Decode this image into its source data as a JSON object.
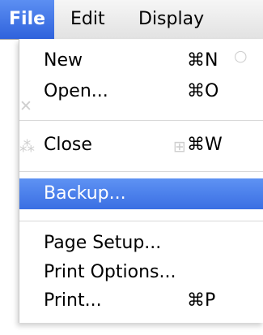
{
  "menubar": {
    "items": [
      {
        "label": "File"
      },
      {
        "label": "Edit"
      },
      {
        "label": "Display"
      }
    ]
  },
  "file_menu": {
    "items": [
      {
        "label": "New",
        "shortcut": "⌘N"
      },
      {
        "label": "Open...",
        "shortcut": "⌘O"
      },
      {
        "label": "Close",
        "shortcut": "⌘W"
      },
      {
        "label": "Backup...",
        "shortcut": ""
      },
      {
        "label": "Page Setup...",
        "shortcut": ""
      },
      {
        "label": "Print Options...",
        "shortcut": ""
      },
      {
        "label": "Print...",
        "shortcut": "⌘P"
      }
    ],
    "highlighted_item": "Backup..."
  },
  "colors": {
    "highlight": "#3a6fe3",
    "menubar_active": "#2f62dc"
  }
}
